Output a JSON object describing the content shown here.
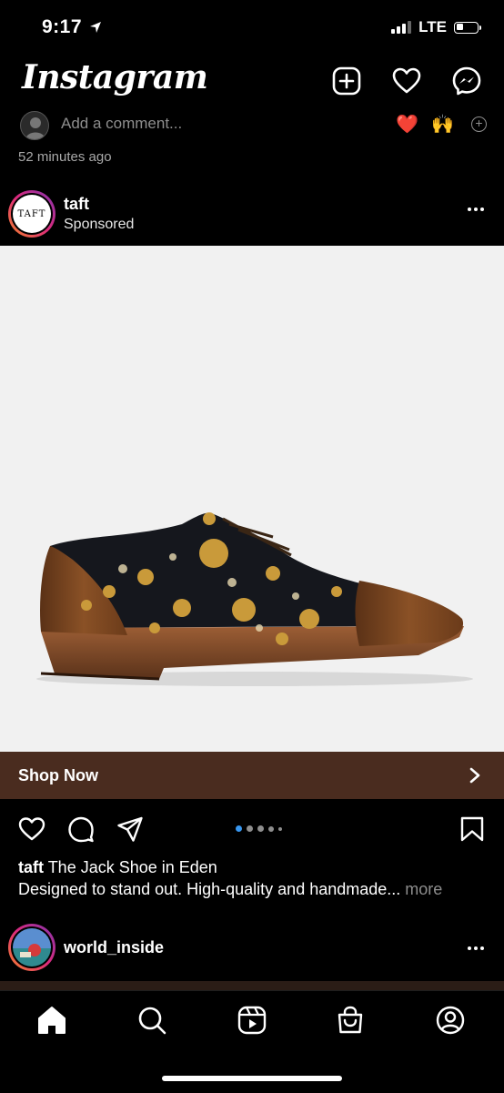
{
  "status_bar": {
    "time": "9:17",
    "network": "LTE",
    "location_icon": "location-arrow-icon"
  },
  "header": {
    "logo": "Instagram",
    "icons": [
      "new-post-icon",
      "heart-icon",
      "messenger-icon"
    ]
  },
  "previous_post": {
    "comment_placeholder": "Add a comment...",
    "quick_reactions": [
      "❤️",
      "🙌"
    ],
    "time_ago": "52 minutes ago"
  },
  "post": {
    "avatar_text": "TAFT",
    "username": "taft",
    "sponsored_label": "Sponsored",
    "cta_label": "Shop Now",
    "carousel": {
      "count": 5,
      "active_index": 0
    },
    "caption": {
      "username": "taft",
      "title": "The Jack Shoe in Eden",
      "body": "Designed to stand out. High-quality and handmade...",
      "more_label": "more"
    },
    "cta_color": "#4a2c1f"
  },
  "next_post": {
    "username": "world_inside"
  },
  "tab_bar": {
    "items": [
      "home-icon",
      "search-icon",
      "reels-icon",
      "shop-icon",
      "profile-icon"
    ]
  },
  "colors": {
    "background": "#000000",
    "secondary_text": "#8e8e8e",
    "carousel_active": "#3897f0"
  }
}
